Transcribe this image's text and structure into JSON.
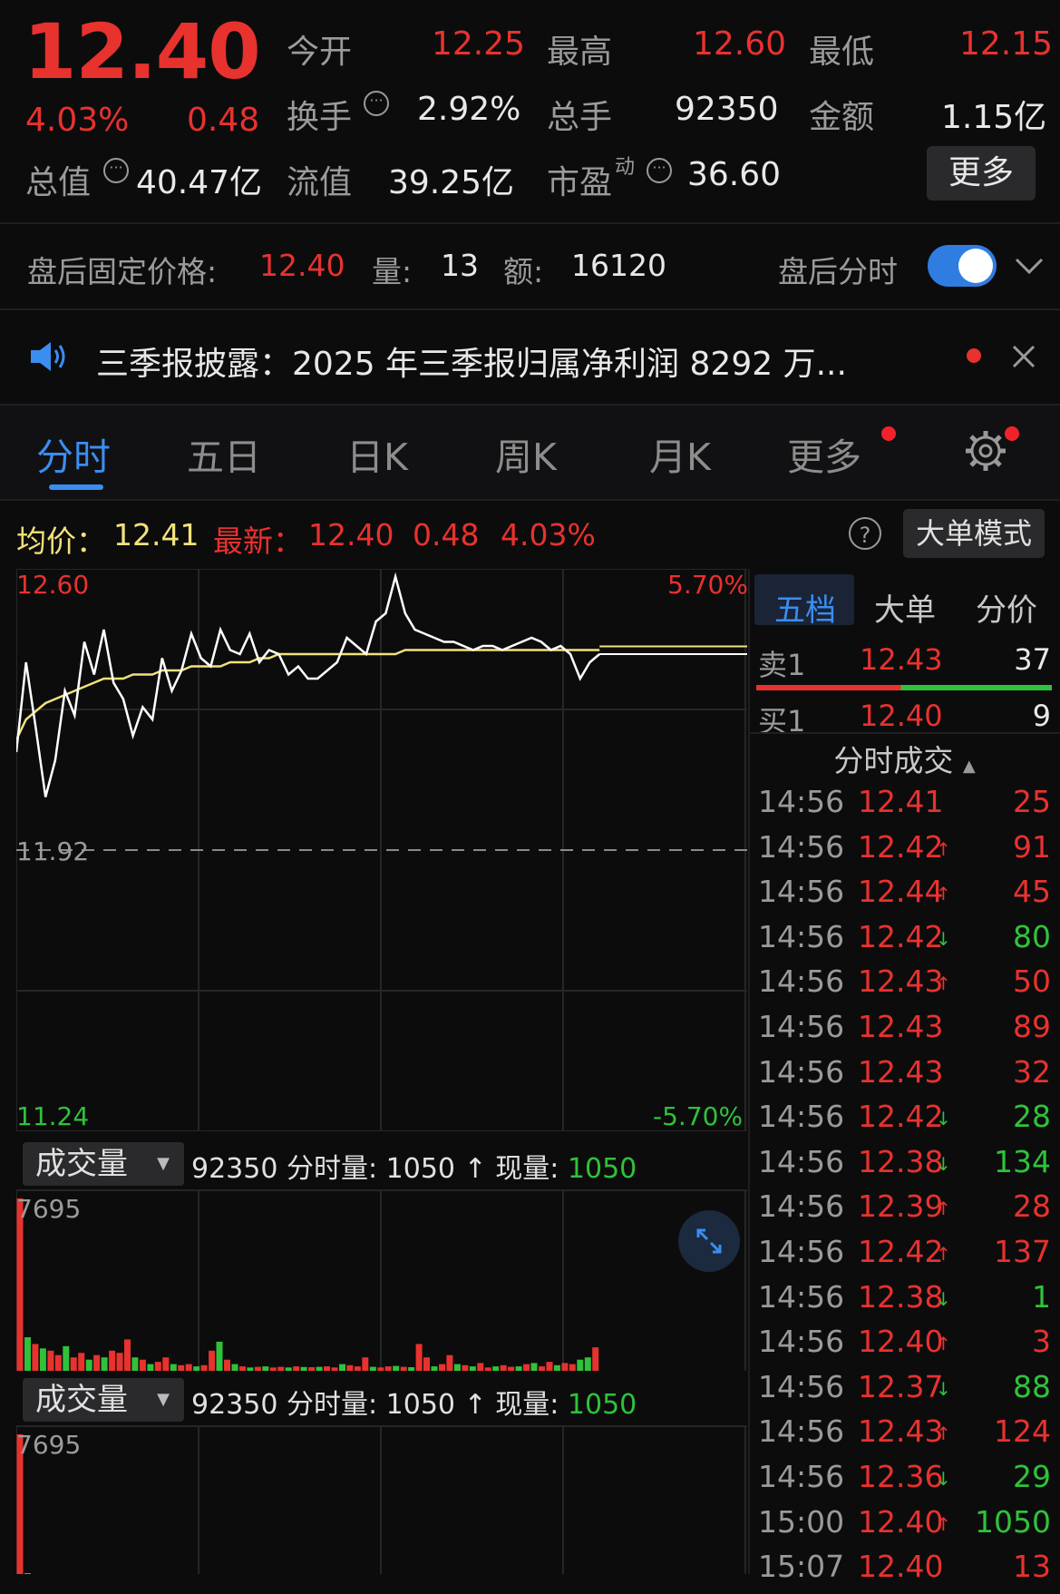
{
  "quote": {
    "price": "12.40",
    "change_pct": "4.03%",
    "change": "0.48",
    "open_label": "今开",
    "open": "12.25",
    "high_label": "最高",
    "high": "12.60",
    "low_label": "最低",
    "low": "12.15",
    "turnover_label": "换手",
    "turnover": "2.92%",
    "volume_label": "总手",
    "volume": "92350",
    "amount_label": "金额",
    "amount": "1.15亿",
    "mktcap_label": "总值",
    "mktcap": "40.47亿",
    "float_label": "流值",
    "float_cap": "39.25亿",
    "pe_label": "市盈",
    "pe_sup": "动",
    "pe": "36.60",
    "more_button": "更多",
    "info_glyph": "···"
  },
  "after_hours": {
    "label": "盘后固定价格:",
    "price": "12.40",
    "vol_label": "量:",
    "vol": "13",
    "amt_label": "额:",
    "amt": "16120",
    "toggle_label": "盘后分时",
    "toggle_on": true
  },
  "notice": {
    "text": "三季报披露：2025 年三季报归属净利润 8292 万..."
  },
  "tabs": [
    "分时",
    "五日",
    "日K",
    "周K",
    "月K",
    "更多"
  ],
  "active_tab": "分时",
  "stat_line": {
    "avg_label": "均价：",
    "avg": "12.41",
    "latest_label": "最新：",
    "latest": "12.40",
    "chg": "0.48",
    "pct": "4.03%",
    "help": "?",
    "big_order_button": "大单模式"
  },
  "chart_labels": {
    "top_price": "12.60",
    "top_pct": "5.70%",
    "mid_price": "11.92",
    "bottom_price": "11.24",
    "bottom_pct": "-5.70%"
  },
  "side_panel": {
    "tabs": [
      "五档",
      "大单",
      "分价"
    ],
    "sell1_label": "卖1",
    "sell1_price": "12.43",
    "sell1_vol": "37",
    "buy1_label": "买1",
    "buy1_price": "12.40",
    "buy1_vol": "9",
    "ticks_header": "分时成交",
    "trades": [
      {
        "time": "14:56",
        "price": "12.41",
        "arrow": "",
        "vol": "25",
        "dir": "up"
      },
      {
        "time": "14:56",
        "price": "12.42",
        "arrow": "↑",
        "vol": "91",
        "dir": "up"
      },
      {
        "time": "14:56",
        "price": "12.44",
        "arrow": "↑",
        "vol": "45",
        "dir": "up"
      },
      {
        "time": "14:56",
        "price": "12.42",
        "arrow": "↓",
        "vol": "80",
        "dir": "down"
      },
      {
        "time": "14:56",
        "price": "12.43",
        "arrow": "↑",
        "vol": "50",
        "dir": "up"
      },
      {
        "time": "14:56",
        "price": "12.43",
        "arrow": "",
        "vol": "89",
        "dir": "up"
      },
      {
        "time": "14:56",
        "price": "12.43",
        "arrow": "",
        "vol": "32",
        "dir": "up"
      },
      {
        "time": "14:56",
        "price": "12.42",
        "arrow": "↓",
        "vol": "28",
        "dir": "down"
      },
      {
        "time": "14:56",
        "price": "12.38",
        "arrow": "↓",
        "vol": "134",
        "dir": "down"
      },
      {
        "time": "14:56",
        "price": "12.39",
        "arrow": "↑",
        "vol": "28",
        "dir": "up"
      },
      {
        "time": "14:56",
        "price": "12.42",
        "arrow": "↑",
        "vol": "137",
        "dir": "up"
      },
      {
        "time": "14:56",
        "price": "12.38",
        "arrow": "↓",
        "vol": "1",
        "dir": "down"
      },
      {
        "time": "14:56",
        "price": "12.40",
        "arrow": "↑",
        "vol": "3",
        "dir": "up"
      },
      {
        "time": "14:56",
        "price": "12.37",
        "arrow": "↓",
        "vol": "88",
        "dir": "down"
      },
      {
        "time": "14:56",
        "price": "12.43",
        "arrow": "↑",
        "vol": "124",
        "dir": "up"
      },
      {
        "time": "14:56",
        "price": "12.36",
        "arrow": "↓",
        "vol": "29",
        "dir": "down"
      },
      {
        "time": "15:00",
        "price": "12.40",
        "arrow": "↑",
        "vol": "1050",
        "dir": "green"
      },
      {
        "time": "15:07",
        "price": "12.40",
        "arrow": "",
        "vol": "13",
        "dir": "up"
      }
    ]
  },
  "volume_panel": {
    "select_label": "成交量",
    "total": "92350",
    "minute_label": "分时量:",
    "minute_vol": "1050",
    "arrow": "↑",
    "current_label": "现量:",
    "current_vol": "1050",
    "max_label": "7695"
  },
  "colors": {
    "up": "#e8322e",
    "down": "#2fc23a",
    "avg": "#f2e27a",
    "price_line": "#ffffff",
    "accent": "#2f7de1"
  },
  "chart_data": {
    "type": "line",
    "ylim": [
      11.24,
      12.6
    ],
    "prev_close": 11.92,
    "series": [
      {
        "values": [
          12.16,
          12.38,
          12.22,
          12.05,
          12.14,
          12.31,
          12.25,
          12.43,
          12.35,
          12.46,
          12.33,
          12.29,
          12.2,
          12.27,
          12.24,
          12.39,
          12.31,
          12.36,
          12.45,
          12.39,
          12.37,
          12.46,
          12.41,
          12.4,
          12.45,
          12.38,
          12.41,
          12.4,
          12.35,
          12.37,
          12.34,
          12.34,
          12.36,
          12.38,
          12.44,
          12.42,
          12.4,
          12.48,
          12.5,
          12.59,
          12.5,
          12.46,
          12.45,
          12.44,
          12.43,
          12.43,
          12.42,
          12.41,
          12.42,
          12.42,
          12.41,
          12.42,
          12.43,
          12.44,
          12.43,
          12.41,
          12.42,
          12.4,
          12.34,
          12.38,
          12.4
        ]
      },
      {
        "values": [
          12.19,
          12.24,
          12.26,
          12.28,
          12.29,
          12.3,
          12.31,
          12.32,
          12.33,
          12.34,
          12.34,
          12.34,
          12.35,
          12.35,
          12.35,
          12.36,
          12.36,
          12.36,
          12.37,
          12.37,
          12.37,
          12.37,
          12.38,
          12.38,
          12.38,
          12.39,
          12.39,
          12.4,
          12.4,
          12.4,
          12.4,
          12.4,
          12.4,
          12.4,
          12.4,
          12.4,
          12.4,
          12.4,
          12.4,
          12.4,
          12.41,
          12.41,
          12.41,
          12.41,
          12.41,
          12.41,
          12.41,
          12.41,
          12.41,
          12.41,
          12.41,
          12.41,
          12.41,
          12.41,
          12.41,
          12.41,
          12.41,
          12.41,
          12.41,
          12.41,
          12.41
        ]
      }
    ],
    "volume_max": 7695,
    "volume": [
      {
        "v": 7695,
        "d": "up"
      },
      {
        "v": 1500,
        "d": "down"
      },
      {
        "v": 1200,
        "d": "up"
      },
      {
        "v": 1000,
        "d": "down"
      },
      {
        "v": 900,
        "d": "up"
      },
      {
        "v": 700,
        "d": "up"
      },
      {
        "v": 1100,
        "d": "down"
      },
      {
        "v": 600,
        "d": "up"
      },
      {
        "v": 800,
        "d": "up"
      },
      {
        "v": 500,
        "d": "down"
      },
      {
        "v": 700,
        "d": "up"
      },
      {
        "v": 600,
        "d": "down"
      },
      {
        "v": 900,
        "d": "up"
      },
      {
        "v": 800,
        "d": "up"
      },
      {
        "v": 1400,
        "d": "up"
      },
      {
        "v": 600,
        "d": "down"
      },
      {
        "v": 500,
        "d": "up"
      },
      {
        "v": 300,
        "d": "down"
      },
      {
        "v": 400,
        "d": "up"
      },
      {
        "v": 600,
        "d": "up"
      },
      {
        "v": 300,
        "d": "down"
      },
      {
        "v": 250,
        "d": "up"
      },
      {
        "v": 300,
        "d": "up"
      },
      {
        "v": 200,
        "d": "down"
      },
      {
        "v": 250,
        "d": "up"
      },
      {
        "v": 900,
        "d": "up"
      },
      {
        "v": 1300,
        "d": "down"
      },
      {
        "v": 500,
        "d": "up"
      },
      {
        "v": 300,
        "d": "down"
      },
      {
        "v": 200,
        "d": "up"
      },
      {
        "v": 150,
        "d": "down"
      },
      {
        "v": 180,
        "d": "up"
      },
      {
        "v": 200,
        "d": "down"
      },
      {
        "v": 150,
        "d": "up"
      },
      {
        "v": 180,
        "d": "up"
      },
      {
        "v": 150,
        "d": "down"
      },
      {
        "v": 200,
        "d": "up"
      },
      {
        "v": 170,
        "d": "down"
      },
      {
        "v": 160,
        "d": "up"
      },
      {
        "v": 180,
        "d": "down"
      },
      {
        "v": 200,
        "d": "up"
      },
      {
        "v": 150,
        "d": "up"
      },
      {
        "v": 300,
        "d": "down"
      },
      {
        "v": 250,
        "d": "up"
      },
      {
        "v": 200,
        "d": "up"
      },
      {
        "v": 600,
        "d": "up"
      },
      {
        "v": 180,
        "d": "down"
      },
      {
        "v": 150,
        "d": "up"
      },
      {
        "v": 200,
        "d": "up"
      },
      {
        "v": 220,
        "d": "down"
      },
      {
        "v": 180,
        "d": "up"
      },
      {
        "v": 160,
        "d": "down"
      },
      {
        "v": 1200,
        "d": "up"
      },
      {
        "v": 600,
        "d": "up"
      },
      {
        "v": 200,
        "d": "down"
      },
      {
        "v": 300,
        "d": "up"
      },
      {
        "v": 700,
        "d": "up"
      },
      {
        "v": 300,
        "d": "down"
      },
      {
        "v": 250,
        "d": "up"
      },
      {
        "v": 200,
        "d": "down"
      },
      {
        "v": 350,
        "d": "up"
      },
      {
        "v": 150,
        "d": "up"
      },
      {
        "v": 200,
        "d": "down"
      },
      {
        "v": 250,
        "d": "up"
      },
      {
        "v": 180,
        "d": "up"
      },
      {
        "v": 200,
        "d": "down"
      },
      {
        "v": 300,
        "d": "up"
      },
      {
        "v": 350,
        "d": "down"
      },
      {
        "v": 200,
        "d": "up"
      },
      {
        "v": 400,
        "d": "up"
      },
      {
        "v": 250,
        "d": "down"
      },
      {
        "v": 350,
        "d": "up"
      },
      {
        "v": 300,
        "d": "up"
      },
      {
        "v": 500,
        "d": "down"
      },
      {
        "v": 600,
        "d": "down"
      },
      {
        "v": 1050,
        "d": "up"
      }
    ]
  }
}
